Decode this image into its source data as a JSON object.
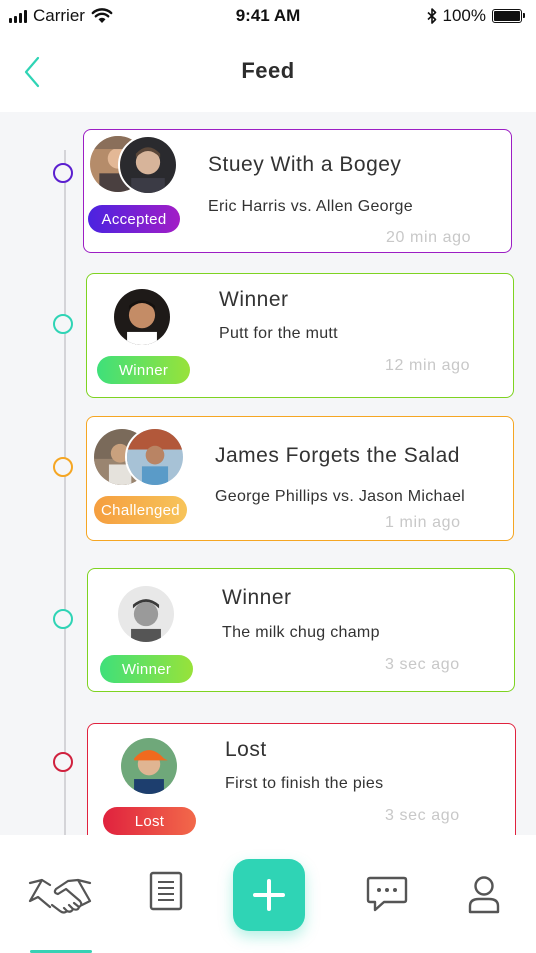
{
  "status_bar": {
    "carrier": "Carrier",
    "time": "9:41 AM",
    "battery": "100%",
    "battery_level": 1.0
  },
  "nav": {
    "title": "Feed"
  },
  "colors": {
    "accent": "#2fd4b5",
    "accepted": "#9c1ec4",
    "winner": "#7ed321",
    "challenged": "#f5a623",
    "lost": "#e0223e"
  },
  "feed": [
    {
      "title": "Stuey With a Bogey",
      "subtitle": "Eric Harris vs. Allen George",
      "time": "20 min ago",
      "badge": "Accepted"
    },
    {
      "title": "Winner",
      "subtitle": "Putt for the mutt",
      "time": "12 min ago",
      "badge": "Winner"
    },
    {
      "title": "James Forgets the Salad",
      "subtitle": "George Phillips vs. Jason Michael",
      "time": "1 min ago",
      "badge": "Challenged"
    },
    {
      "title": "Winner",
      "subtitle": "The milk chug champ",
      "time": "3 sec ago",
      "badge": "Winner"
    },
    {
      "title": "Lost",
      "subtitle": "First to finish the pies",
      "time": "3 sec ago",
      "badge": "Lost"
    }
  ],
  "tab_bar": {
    "tabs": [
      {
        "icon": "handshake-icon"
      },
      {
        "icon": "document-icon"
      },
      {
        "icon": "plus-icon"
      },
      {
        "icon": "chat-icon"
      },
      {
        "icon": "profile-icon"
      }
    ],
    "active": "handshake-icon"
  }
}
